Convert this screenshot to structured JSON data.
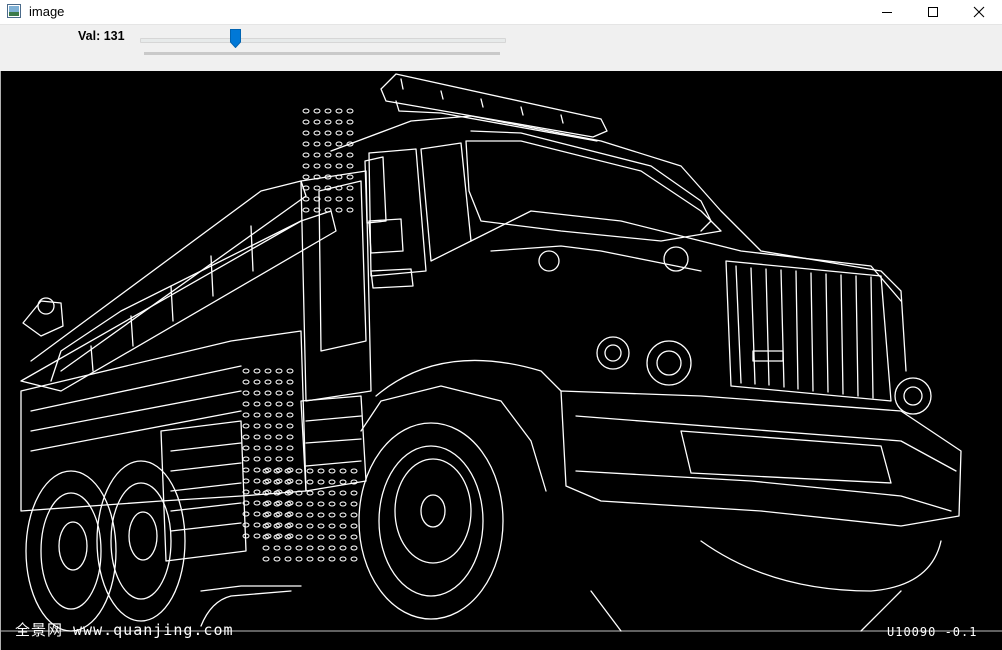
{
  "window": {
    "title": "image",
    "icons": {
      "app": "app-window-icon",
      "minimize": "minimize-icon",
      "maximize": "maximize-icon",
      "close": "close-icon"
    }
  },
  "trackbar": {
    "label": "Val: 131",
    "value": 131,
    "min": 0,
    "max": 500,
    "accent_color": "#0078d7"
  },
  "image": {
    "description_icon": "edge-detection-fire-truck-image",
    "watermark_left": "全景网 www.quanjing.com",
    "watermark_right": "U10090 -0.1"
  }
}
